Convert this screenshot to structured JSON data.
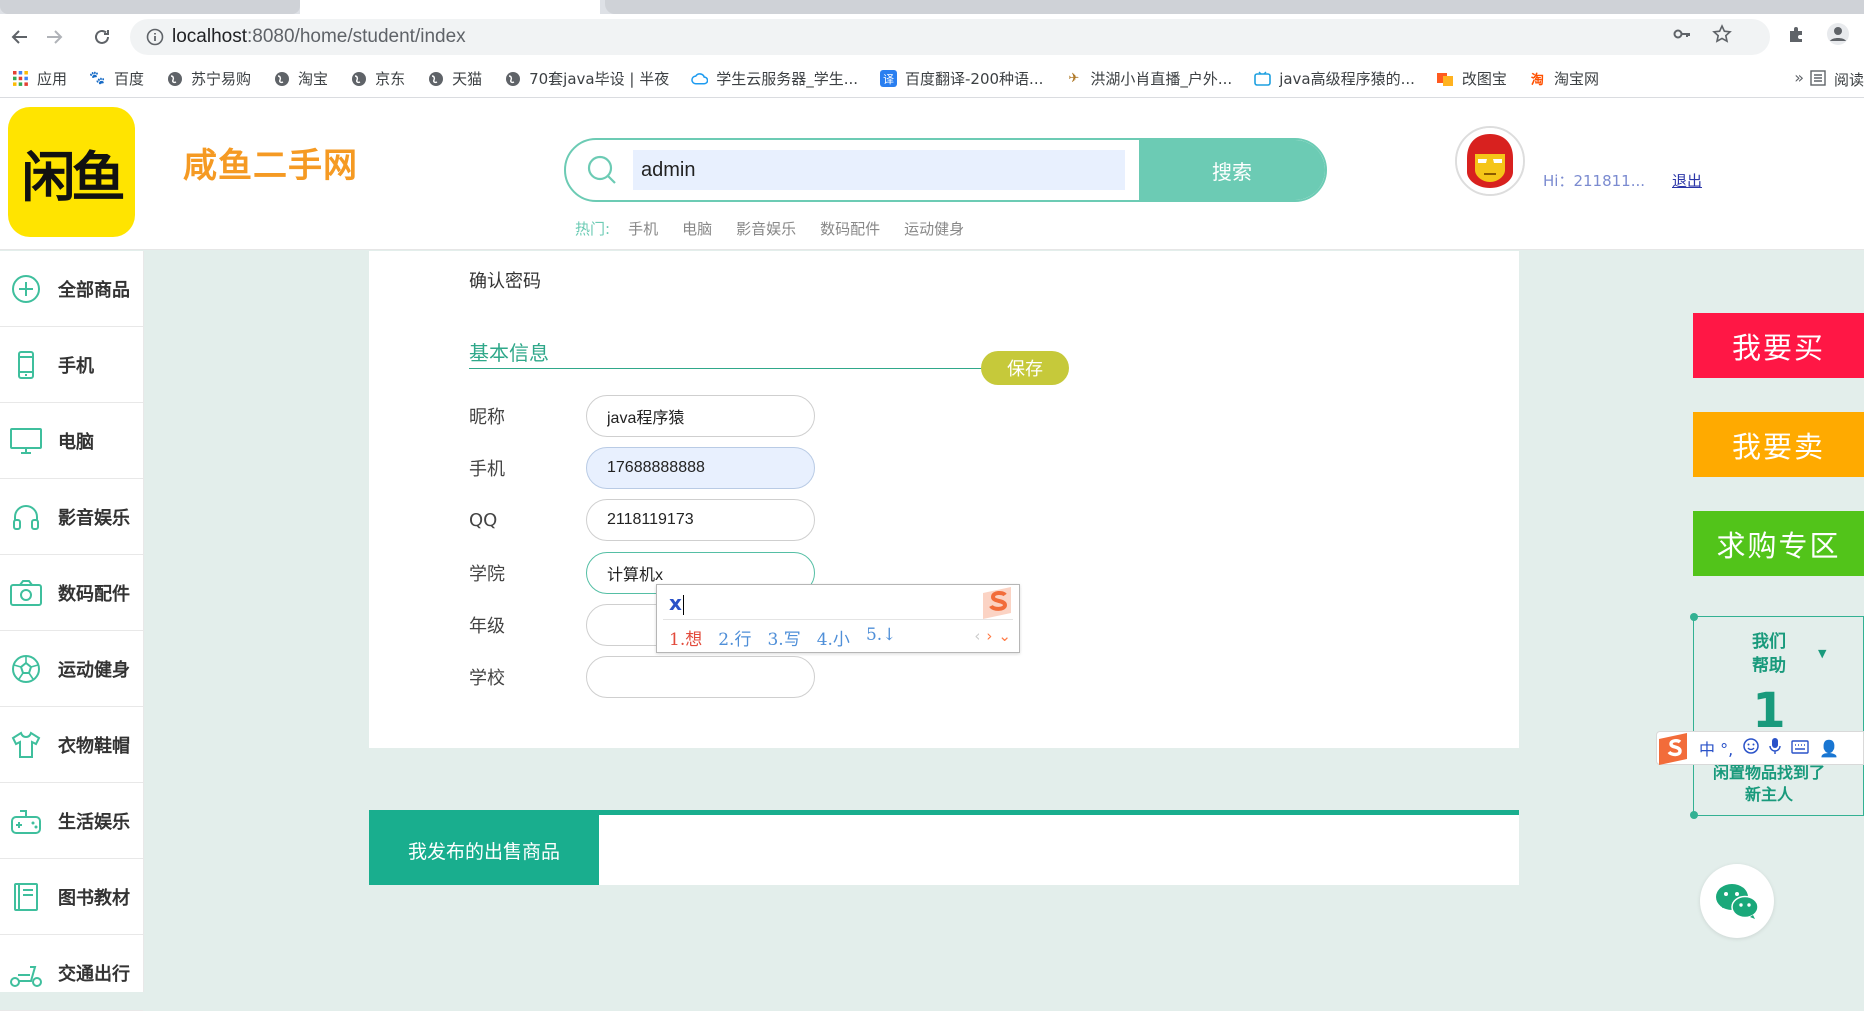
{
  "browser": {
    "url_host": "localhost",
    "url_rest": ":8080/home/student/index",
    "bookmarks": [
      "应用",
      "百度",
      "苏宁易购",
      "淘宝",
      "京东",
      "天猫",
      "70套java毕设 | 半夜",
      "学生云服务器_学生...",
      "百度翻译-200种语...",
      "洪湖小肖直播_户外...",
      "java高级程序猿的...",
      "改图宝",
      "淘宝网"
    ],
    "bookmarks_more": "»",
    "reading_list": "阅读"
  },
  "header": {
    "logo_text": "闲鱼",
    "site_title": "咸鱼二手网",
    "search_value": "admin",
    "search_button": "搜索",
    "hot_label": "热门:",
    "hot_links": [
      "手机",
      "电脑",
      "影音娱乐",
      "数码配件",
      "运动健身"
    ],
    "greeting": "Hi：211811...",
    "logout": "退出"
  },
  "sidebar": {
    "items": [
      {
        "label": "全部商品",
        "icon": "plus-circle-icon"
      },
      {
        "label": "手机",
        "icon": "phone-icon"
      },
      {
        "label": "电脑",
        "icon": "monitor-icon"
      },
      {
        "label": "影音娱乐",
        "icon": "headphones-icon"
      },
      {
        "label": "数码配件",
        "icon": "camera-icon"
      },
      {
        "label": "运动健身",
        "icon": "football-icon"
      },
      {
        "label": "衣物鞋帽",
        "icon": "shirt-icon"
      },
      {
        "label": "生活娱乐",
        "icon": "gamepad-icon"
      },
      {
        "label": "图书教材",
        "icon": "book-icon"
      },
      {
        "label": "交通出行",
        "icon": "scooter-icon"
      }
    ]
  },
  "form": {
    "confirm_password_label": "确认密码",
    "section_title": "基本信息",
    "save_button": "保存",
    "fields": [
      {
        "label": "昵称",
        "value": "java程序猿"
      },
      {
        "label": "手机",
        "value": "17688888888"
      },
      {
        "label": "QQ",
        "value": "2118119173"
      },
      {
        "label": "学院",
        "value": "计算机x"
      },
      {
        "label": "年级",
        "value": ""
      },
      {
        "label": "学校",
        "value": ""
      }
    ]
  },
  "ime": {
    "composition": "x",
    "candidates": [
      "1.想",
      "2.行",
      "3.写",
      "4.小",
      "5.↓"
    ],
    "bar_text": "中 °,"
  },
  "tabs": {
    "active": "我发布的出售商品"
  },
  "floating": {
    "buy": "我要买",
    "sell": "我要卖",
    "want": "求购专区",
    "help_line1": "我们",
    "help_line2": "帮助",
    "help_number": "1",
    "help_line3": "闲置物品找到了",
    "help_line4": "新主人"
  },
  "colors": {
    "accent": "#6ccbb4",
    "section": "#2fa88a",
    "save": "#c6c93a",
    "buy": "#ff1745",
    "sell": "#ffaa00",
    "want": "#52c41a",
    "title": "#f59a23"
  }
}
